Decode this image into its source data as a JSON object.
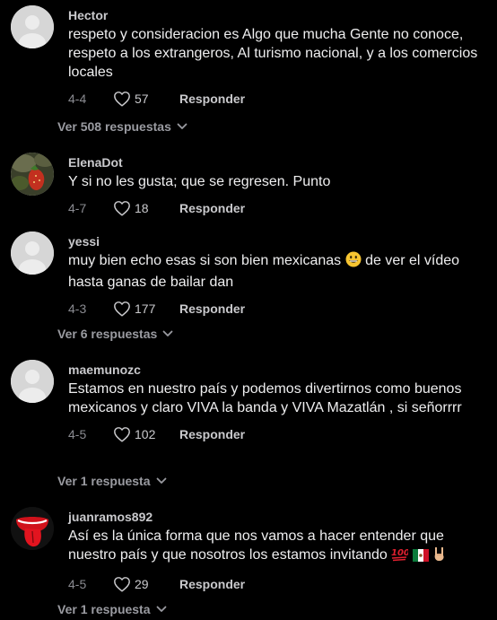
{
  "colors": {
    "background": "#000000",
    "username": "#c9c9cc",
    "text": "#eeeeef",
    "muted": "#8a8b91"
  },
  "comments": [
    {
      "username": "Hector",
      "text": "respeto y consideracion es Algo que mucha Gente no conoce, respeto a los extrangeros, Al turismo nacional, y a los comercios locales",
      "date": "4-4",
      "likes": "57",
      "reply_label": "Responder",
      "view_replies": "Ver 508 respuestas",
      "avatar": "default-avatar-icon"
    },
    {
      "username": "ElenaDot",
      "text": "Y si no les gusta; que se regresen. Punto",
      "date": "4-7",
      "likes": "18",
      "reply_label": "Responder",
      "avatar": "strawberry-photo-avatar"
    },
    {
      "username": "yessi",
      "text_before": "muy bien echo esas si son bien mexicanas",
      "text_emoji": "grinning-face-emoji",
      "text_after": "de ver el vídeo hasta ganas de bailar dan",
      "date": "4-3",
      "likes": "177",
      "reply_label": "Responder",
      "view_replies": "Ver 6 respuestas",
      "avatar": "default-avatar-icon"
    },
    {
      "username": "maemunozc",
      "text": "Estamos en nuestro país y podemos divertirnos como buenos mexicanos y claro VIVA la banda y VIVA Mazatlán , si señorrrr",
      "date": "4-5",
      "likes": "102",
      "reply_label": "Responder",
      "view_replies": "Ver 1 respuesta",
      "avatar": "default-avatar-icon"
    },
    {
      "username": "juanramos892",
      "text": "Así es la única forma que nos vamos a hacer entender que nuestro país y que nosotros los estamos invitando",
      "text_emojis": [
        "hundred-points-emoji",
        "mexico-flag-emoji",
        "rock-on-hand-emoji"
      ],
      "date": "4-5",
      "likes": "29",
      "reply_label": "Responder",
      "view_replies": "Ver 1 respuesta",
      "avatar": "rolling-stones-tongue-avatar"
    }
  ]
}
